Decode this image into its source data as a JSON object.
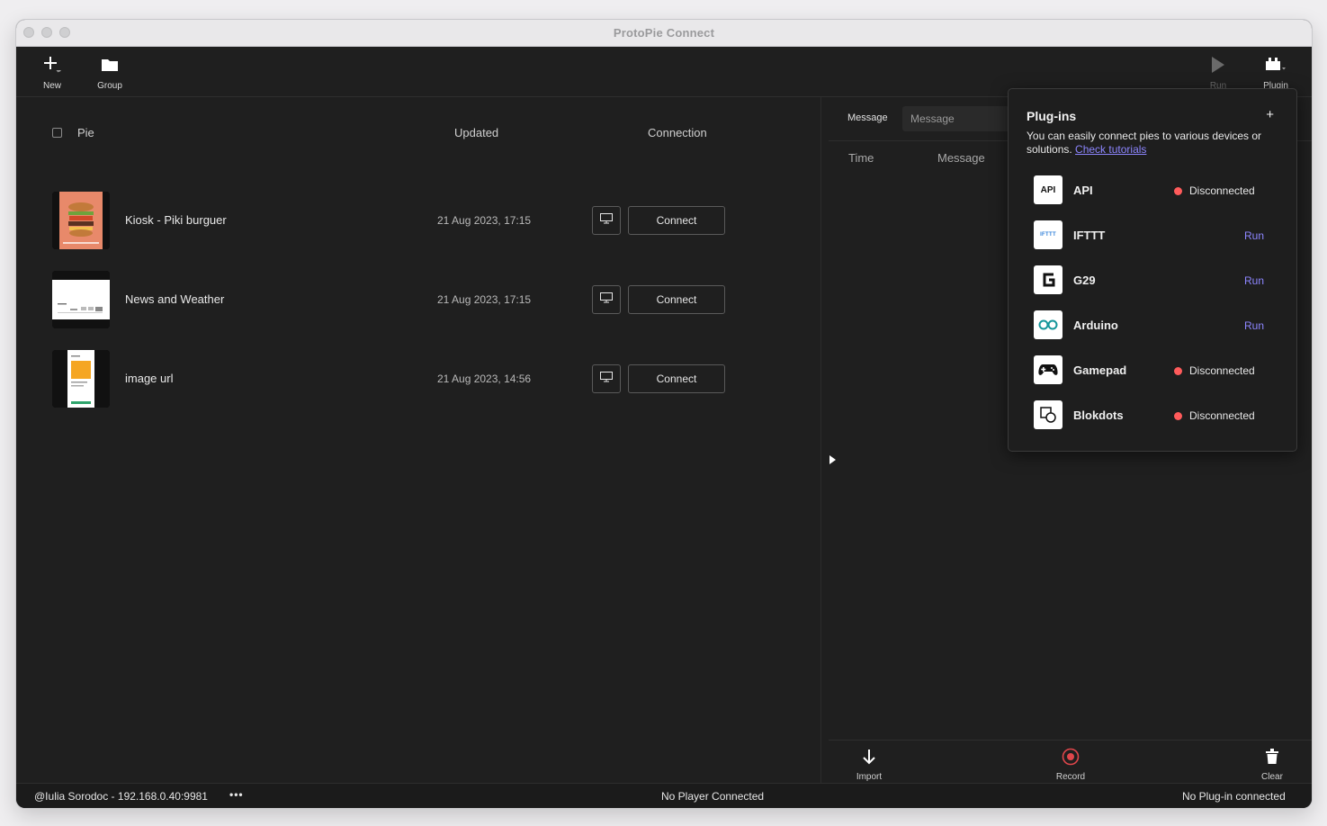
{
  "window": {
    "title": "ProtoPie Connect"
  },
  "toolbar": {
    "new_label": "New",
    "group_label": "Group",
    "run_label": "Run",
    "plugin_label": "Plugin"
  },
  "table": {
    "col_pie": "Pie",
    "col_updated": "Updated",
    "col_connection": "Connection"
  },
  "pies": [
    {
      "name": "Kiosk - Piki burguer",
      "updated": "21 Aug 2023, 17:15",
      "connect_label": "Connect"
    },
    {
      "name": "News and Weather",
      "updated": "21 Aug 2023, 17:15",
      "connect_label": "Connect"
    },
    {
      "name": "image url",
      "updated": "21 Aug 2023, 14:56",
      "connect_label": "Connect"
    }
  ],
  "messages": {
    "label": "Message",
    "input_placeholder": "Message",
    "col_time": "Time",
    "col_message": "Message",
    "import_label": "Import",
    "record_label": "Record",
    "clear_label": "Clear"
  },
  "plugins": {
    "title": "Plug-ins",
    "add_symbol": "+",
    "description": "You can easily connect pies to various devices or solutions.",
    "tutorial_link": "Check tutorials",
    "items": [
      {
        "name": "API",
        "icon": "api-icon",
        "icon_text": "API",
        "status": "Disconnected",
        "action": ""
      },
      {
        "name": "IFTTT",
        "icon": "ifttt-icon",
        "icon_text": "IFTTT",
        "status": "",
        "action": "Run"
      },
      {
        "name": "G29",
        "icon": "g29-icon",
        "icon_text": "",
        "status": "",
        "action": "Run"
      },
      {
        "name": "Arduino",
        "icon": "arduino-icon",
        "icon_text": "",
        "status": "",
        "action": "Run"
      },
      {
        "name": "Gamepad",
        "icon": "gamepad-icon",
        "icon_text": "",
        "status": "Disconnected",
        "action": ""
      },
      {
        "name": "Blokdots",
        "icon": "blokdots-icon",
        "icon_text": "",
        "status": "Disconnected",
        "action": ""
      }
    ]
  },
  "status": {
    "user": "@Iulia Sorodoc - 192.168.0.40:9981",
    "more": "•••",
    "player": "No Player Connected",
    "plugin": "No Plug-in connected"
  },
  "colors": {
    "accent": "#8d86ff",
    "disconnected": "#ff5b5b",
    "record": "#e0464b",
    "background": "#1f1f1f"
  }
}
